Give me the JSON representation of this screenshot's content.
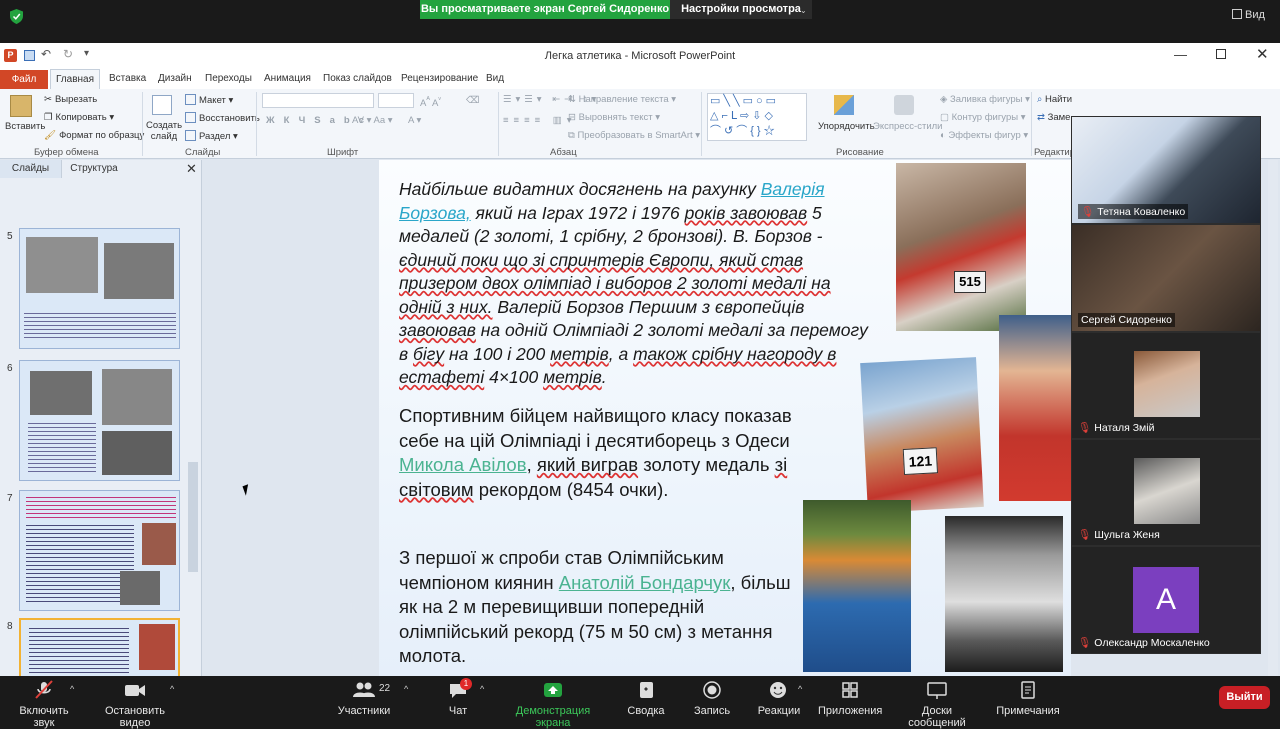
{
  "zoom": {
    "share_banner": "Вы просматриваете экран Сергей Сидоренко",
    "view_settings": "Настройки просмотра",
    "view_btn": "Вид",
    "toolbar": {
      "mute": "Включить звук",
      "video": "Остановить видео",
      "participants": "Участники",
      "participants_count": "22",
      "chat": "Чат",
      "chat_badge": "1",
      "share": "Демонстрация экрана",
      "summary": "Сводка",
      "record": "Запись",
      "reactions": "Реакции",
      "apps": "Приложения",
      "whiteboards": "Доски сообщений",
      "notes": "Примечания",
      "leave": "Выйти"
    },
    "participants": [
      {
        "name": "Тетяна  Коваленко"
      },
      {
        "name": "Сергей Сидоренко"
      },
      {
        "name": "Наталя Змій"
      },
      {
        "name": "Шульга Женя"
      },
      {
        "name": "Олександр Москаленко",
        "initial": "A",
        "color": "#7b3fbf"
      }
    ]
  },
  "ppt": {
    "title": "Легка атлетика  -  Microsoft PowerPoint",
    "tabs": [
      "Файл",
      "Главная",
      "Вставка",
      "Дизайн",
      "Переходы",
      "Анимация",
      "Показ слайдов",
      "Рецензирование",
      "Вид"
    ],
    "ribbon": {
      "paste": "Вставить",
      "cut": "Вырезать",
      "copy": "Копировать",
      "format_painter": "Формат по образцу",
      "clipboard": "Буфер обмена",
      "new_slide": "Создать слайд",
      "layout": "Макет",
      "reset": "Восстановить",
      "section": "Раздел",
      "slides_group": "Слайды",
      "font_group": "Шрифт",
      "text_direction": "Направление текста",
      "align_text": "Выровнять текст",
      "smartart": "Преобразовать в SmartArt",
      "paragraph_group": "Абзац",
      "arrange": "Упорядочить",
      "quick_styles": "Экспресс-стили",
      "shape_fill": "Заливка фигуры",
      "shape_outline": "Контур фигуры",
      "shape_effects": "Эффекты фигур",
      "drawing_group": "Рисование",
      "find": "Найти",
      "replace": "Заме",
      "editing_group": "Редактир"
    },
    "panel_tabs": {
      "slides": "Слайды",
      "outline": "Структура"
    },
    "thumb_numbers": [
      "5",
      "6",
      "7",
      "8"
    ],
    "slide": {
      "p1_a": "Найбільше видатних досягнень на рахунку ",
      "p1_link": "Валерія Борзова,",
      "p1_b": " який на Іграх 1972 і 1976 ",
      "p1_c": "років завоював",
      "p1_d": " 5 медалей (2 золоті, 1 срібну, 2 бронзові). В. Борзов - ",
      "p1_e": "єдиний поки що зі спринтерів Європи, який став призером двох олімпіад і виборов 2 золоті медалі на одній з них.",
      "p1_f": " Валерій Борзов Першим з європейців ",
      "p1_g": "завоював",
      "p1_h": " на одній Олімпіаді 2 золоті медалі за перемогу в ",
      "p1_i": "бігу",
      "p1_j": " на 100 і 200 ",
      "p1_k": "метрів",
      "p1_l": ", а ",
      "p1_m": "також срібну нагороду в естафеті",
      "p1_n": " 4×100 ",
      "p1_o": "метрів",
      "p1_p": ".",
      "p2_a": "Спортивним бійцем найвищого класу показав себе на цій Олімпіаді і десятиборець з Одеси ",
      "p2_link": "Микола Авілов",
      "p2_b": ", ",
      "p2_c": "який виграв",
      "p2_d": " золоту медаль ",
      "p2_e": "зі світовим",
      "p2_f": " рекордом (8454 очки).",
      "p3_a": " З першої ж спроби став Олімпійським чемпіоном киянин ",
      "p3_link": "Анатолій Бондарчук",
      "p3_b": ", більш як на 2 м перевищивши попередній олімпійський рекорд (75 м 50 см) з метання молота.",
      "bib_1": "515",
      "bib_2": "121"
    }
  }
}
